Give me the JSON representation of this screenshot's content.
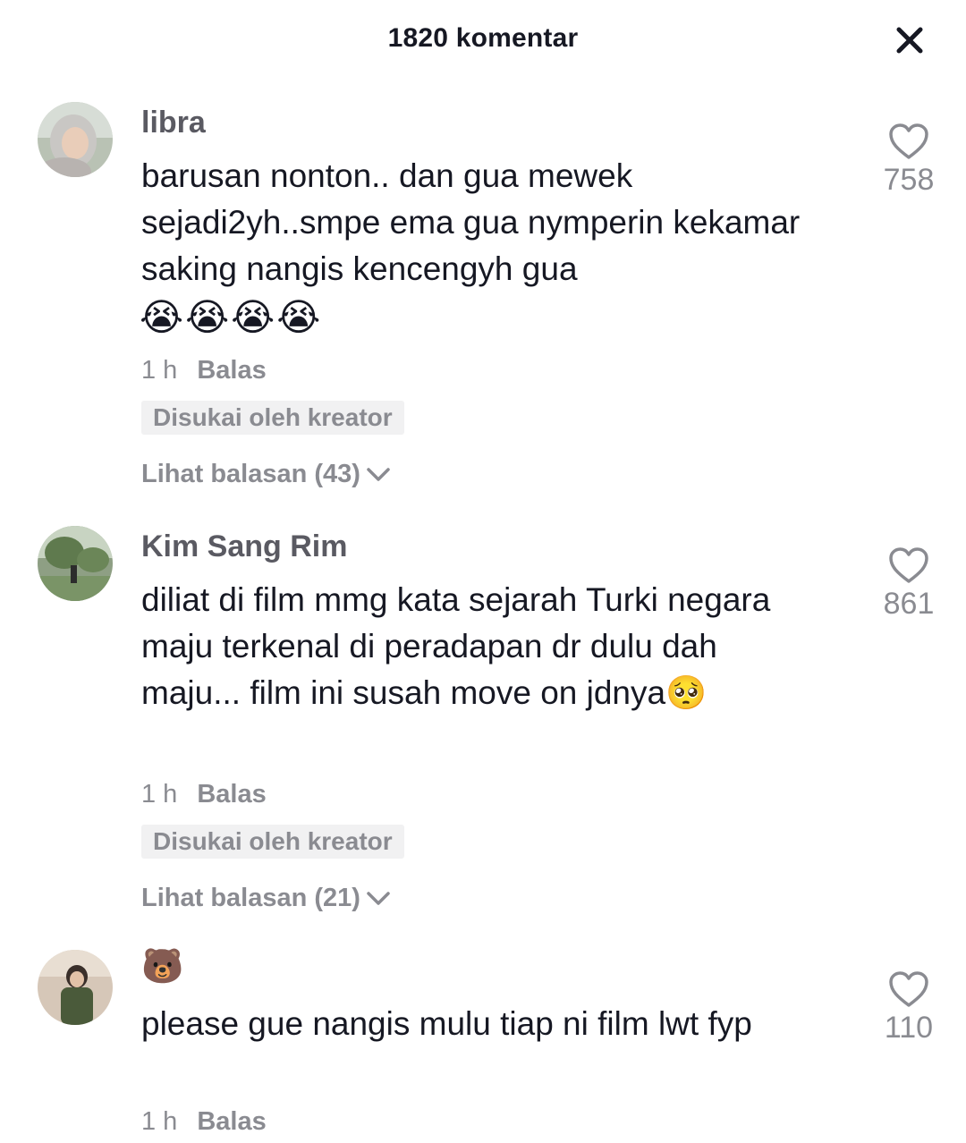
{
  "header": {
    "title": "1820 komentar",
    "close_icon": "close-icon"
  },
  "comments": [
    {
      "username": "libra",
      "text": "barusan nonton.. dan gua mewek sejadi2yh..smpe ema gua nymperin kekamar saking nangis kencengyh gua",
      "emojis": "😭😭😭😭",
      "time": "1 h",
      "reply_label": "Balas",
      "badge": "Disukai oleh kreator",
      "view_replies": "Lihat balasan (43)",
      "likes": "758",
      "like_icon": "heart-outline-icon"
    },
    {
      "username": "Kim Sang Rim",
      "text": "diliat di film mmg kata sejarah Turki negara maju terkenal di peradapan dr dulu dah maju... film ini susah move on jdnya🥺",
      "time": "1 h",
      "reply_label": "Balas",
      "badge": "Disukai oleh kreator",
      "view_replies": "Lihat balasan (21)",
      "likes": "861",
      "like_icon": "heart-outline-icon"
    },
    {
      "username": "🐻",
      "text": "please gue nangis mulu tiap ni film lwt fyp",
      "time": "1 h",
      "reply_label": "Balas",
      "likes": "110",
      "like_icon": "heart-outline-icon"
    }
  ],
  "colors": {
    "primary_text": "#161823",
    "secondary_text": "#8a8b91",
    "badge_bg": "#f1f1f2"
  }
}
